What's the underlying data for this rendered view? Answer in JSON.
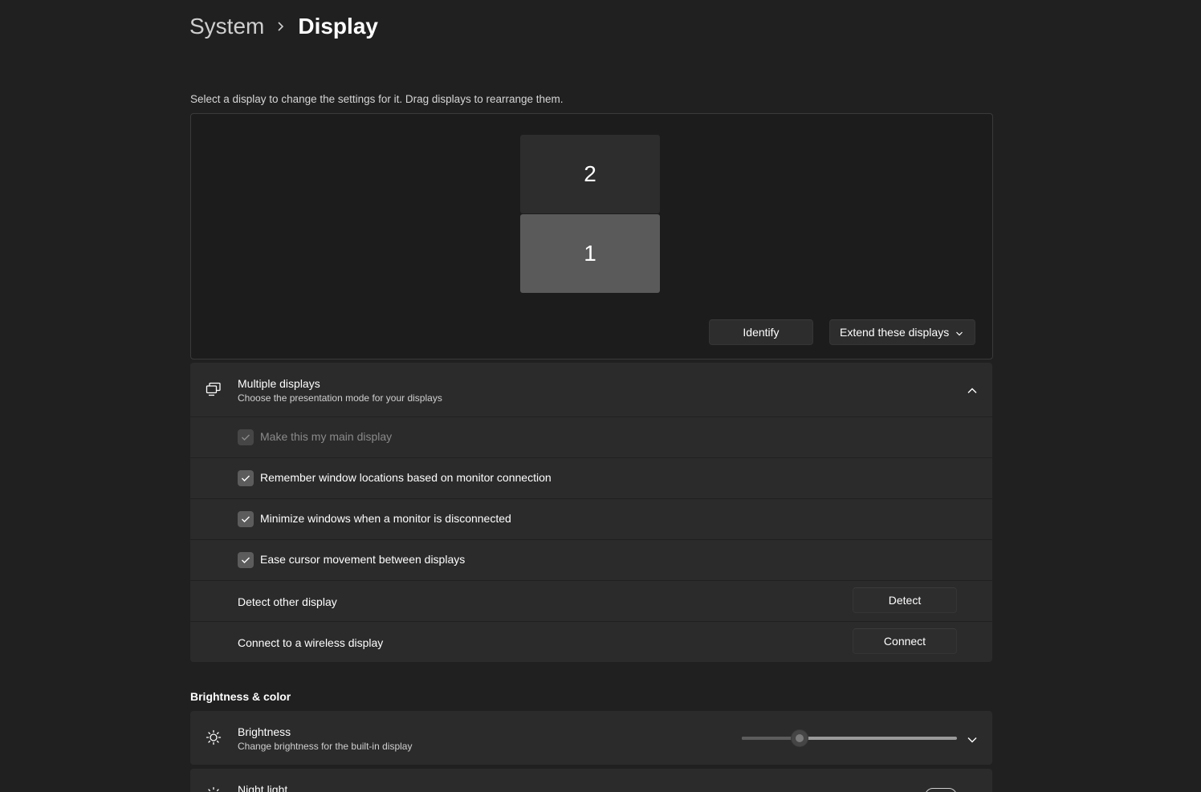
{
  "breadcrumb": {
    "parent": "System",
    "current": "Display"
  },
  "arrangement": {
    "hint": "Select a display to change the settings for it. Drag displays to rearrange them.",
    "monitors": [
      "2",
      "1"
    ],
    "identify_label": "Identify",
    "mode_selected": "Extend these displays"
  },
  "multiple_displays": {
    "title": "Multiple displays",
    "subtitle": "Choose the presentation mode for your displays",
    "options": [
      {
        "label": "Make this my main display",
        "checked": true,
        "disabled": true
      },
      {
        "label": "Remember window locations based on monitor connection",
        "checked": true,
        "disabled": false
      },
      {
        "label": "Minimize windows when a monitor is disconnected",
        "checked": true,
        "disabled": false
      },
      {
        "label": "Ease cursor movement between displays",
        "checked": true,
        "disabled": false
      }
    ],
    "detect": {
      "label": "Detect other display",
      "button": "Detect"
    },
    "connect": {
      "label": "Connect to a wireless display",
      "button": "Connect"
    }
  },
  "brightness_section": {
    "title": "Brightness & color",
    "brightness": {
      "title": "Brightness",
      "subtitle": "Change brightness for the built-in display",
      "level": 0.27
    },
    "night_light": {
      "title": "Night light"
    }
  },
  "colors": {
    "background": "#202020",
    "card": "#2b2b2b",
    "monitor_selected": "#5a5a5a",
    "monitor_other": "#2d2d2d"
  }
}
